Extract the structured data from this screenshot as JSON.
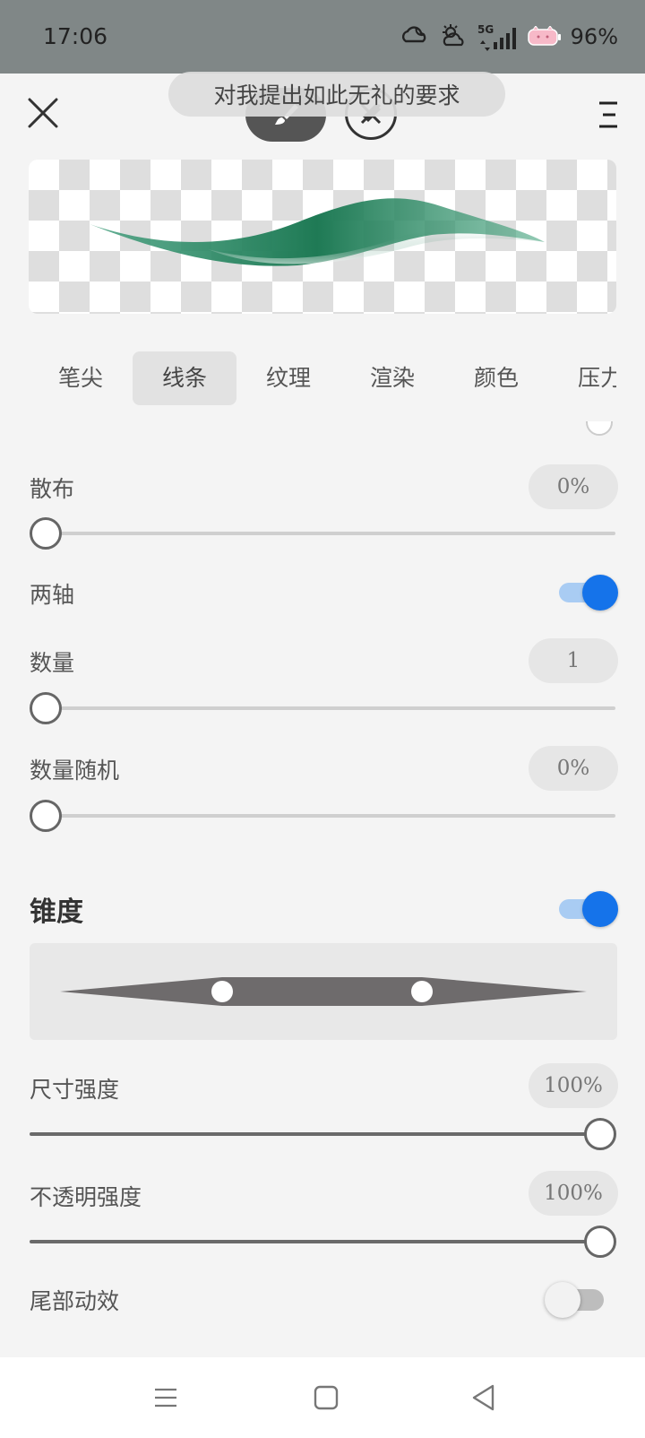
{
  "status_bar": {
    "time": "17:06",
    "network": "5G",
    "battery": "96%",
    "icons": [
      "cloudy-night-icon",
      "cloudy-sun-icon",
      "signal-icon",
      "battery-icon"
    ]
  },
  "toast": {
    "text": "对我提出如此无礼的要求"
  },
  "top_bar": {
    "icons": [
      "close-icon",
      "brush-icon",
      "eraser-icon",
      "menu-icon"
    ]
  },
  "preview": {
    "stroke_color": "#2e8b66"
  },
  "tabs": [
    {
      "label": "笔尖",
      "active": false
    },
    {
      "label": "线条",
      "active": true
    },
    {
      "label": "纹理",
      "active": false
    },
    {
      "label": "渲染",
      "active": false
    },
    {
      "label": "颜色",
      "active": false
    },
    {
      "label": "压力",
      "active": false
    }
  ],
  "settings": {
    "scatter": {
      "label": "散布",
      "value": "0%",
      "slider": 0
    },
    "two_axis": {
      "label": "两轴",
      "on": true
    },
    "count": {
      "label": "数量",
      "value": "1",
      "slider": 0
    },
    "count_random": {
      "label": "数量随机",
      "value": "0%",
      "slider": 0
    },
    "taper": {
      "title": "锥度",
      "on": true
    },
    "size_strength": {
      "label": "尺寸强度",
      "value": "100%",
      "slider": 1
    },
    "opacity_strength": {
      "label": "不透明强度",
      "value": "100%",
      "slider": 1
    },
    "tail_animation": {
      "label": "尾部动效",
      "on": false
    }
  },
  "colors": {
    "accent": "#1573ea",
    "toggle_track_on": "#a9ccf3",
    "status_bar": "#808787"
  },
  "nav_bar": {
    "icons": [
      "recent-apps-icon",
      "home-icon",
      "back-icon"
    ]
  }
}
